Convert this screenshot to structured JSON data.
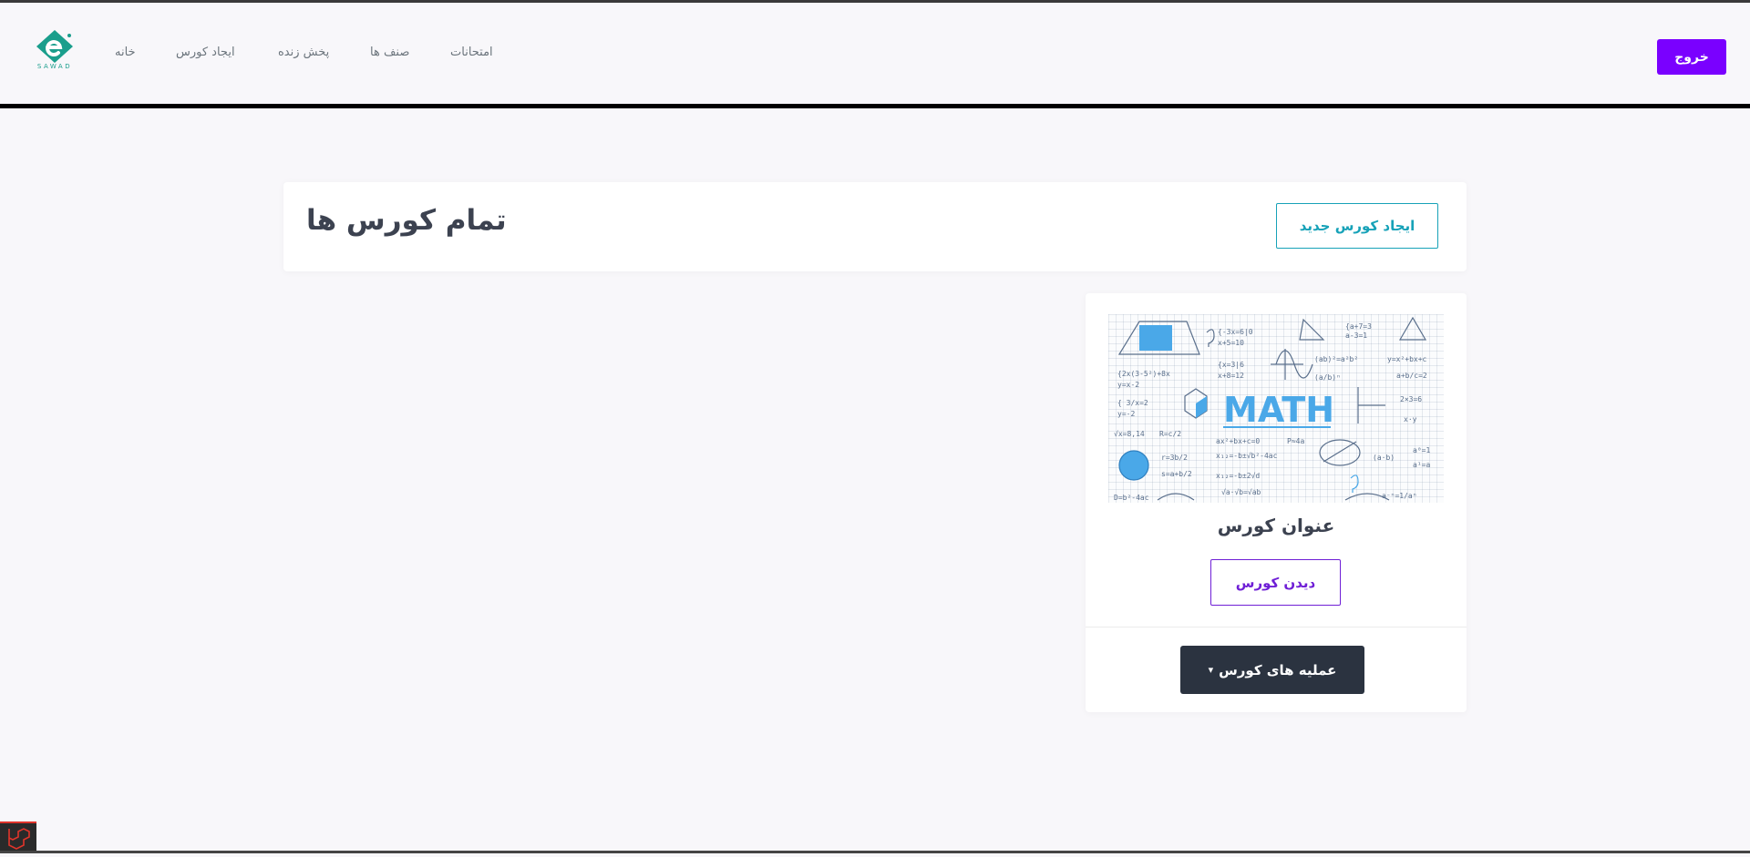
{
  "brand": {
    "logo_text": "SAWAD",
    "accent": "#7a00ff",
    "logo_color": "#1a9e8c"
  },
  "nav": {
    "home": "خانه",
    "create_course": "ایجاد کورس",
    "live": "پخش زنده",
    "classes": "صنف ها",
    "exams": "امتحانات",
    "logout": "خروج"
  },
  "header": {
    "title": "تمام کورس ها",
    "new_course_button": "ایجاد کورس جدید"
  },
  "course_card": {
    "image_text": "MATH",
    "title": "عنوان کورس",
    "view_button": "دیدن کورس",
    "actions_button": "عملیه های کورس",
    "actions_icon": "chevron-down-icon"
  },
  "colors": {
    "teal": "#17a2b8",
    "purple": "#6f1fd6",
    "dark": "#2b3340"
  }
}
